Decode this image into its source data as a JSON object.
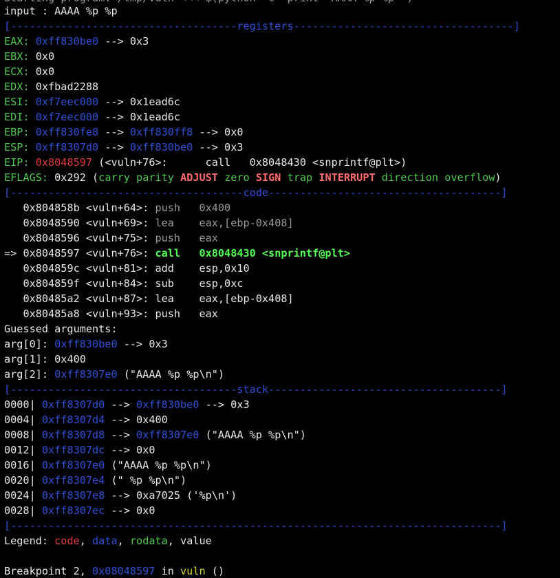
{
  "top_cut": "Starting program: /tmp/vuln <<< $(python -c 'print \"AAAA %p %p\"')",
  "input_line": "input : AAAA %p %p",
  "registers_header": "[------------------------------------registers-----------------------------------]",
  "registers": [
    {
      "name": "EAX:",
      "v1": "0xff830be0",
      "rest": " --> 0x3"
    },
    {
      "name": "EBX:",
      "v1": "",
      "rest": " 0x0"
    },
    {
      "name": "ECX:",
      "v1": "",
      "rest": " 0x0"
    },
    {
      "name": "EDX:",
      "v1": "",
      "rest": " 0xfbad2288"
    },
    {
      "name": "ESI:",
      "v1": "0xf7eec000",
      "rest": " --> 0x1ead6c"
    },
    {
      "name": "EDI:",
      "v1": "0xf7eec000",
      "rest": " --> 0x1ead6c"
    },
    {
      "name": "EBP:",
      "v1": "0xff830fe8",
      "arrow": " --> ",
      "v2": "0xff830ff8",
      "rest": " --> 0x0"
    },
    {
      "name": "ESP:",
      "v1": "0xff8307d0",
      "arrow": " --> ",
      "v2": "0xff830be0",
      "rest": " --> 0x3"
    }
  ],
  "eip": {
    "name": "EIP:",
    "addr": "0x8048597",
    "rest": " (<vuln+76>:      call   0x8048430 <snprintf@plt>)"
  },
  "eflags": {
    "name": "EFLAGS:",
    "value": " 0x292 (",
    "flags": [
      {
        "t": "carry",
        "s": "g"
      },
      {
        "t": "parity",
        "s": "g"
      },
      {
        "t": "ADJUST",
        "s": "r"
      },
      {
        "t": "zero",
        "s": "g"
      },
      {
        "t": "SIGN",
        "s": "r"
      },
      {
        "t": "trap",
        "s": "g"
      },
      {
        "t": "INTERRUPT",
        "s": "r"
      },
      {
        "t": "direction",
        "s": "g"
      },
      {
        "t": "overflow",
        "s": "g"
      }
    ],
    "close": ")"
  },
  "code_header": "[-------------------------------------code-------------------------------------]",
  "code": [
    {
      "prefix": "   ",
      "addr": "0x804858b",
      "sym": " <vuln+64>:",
      "ins": " push   0x400",
      "current": false
    },
    {
      "prefix": "   ",
      "addr": "0x8048590",
      "sym": " <vuln+69>:",
      "ins": " lea    eax,[ebp-0x408]",
      "current": false
    },
    {
      "prefix": "   ",
      "addr": "0x8048596",
      "sym": " <vuln+75>:",
      "ins": " push   eax",
      "current": false
    },
    {
      "prefix": "=> ",
      "addr": "0x8048597",
      "sym": " <vuln+76>:",
      "ins": " call   0x8048430 <snprintf@plt>",
      "current": true
    },
    {
      "prefix": "   ",
      "addr": "0x804859c",
      "sym": " <vuln+81>:",
      "ins": " add    esp,0x10",
      "current": false
    },
    {
      "prefix": "   ",
      "addr": "0x804859f",
      "sym": " <vuln+84>:",
      "ins": " sub    esp,0xc",
      "current": false
    },
    {
      "prefix": "   ",
      "addr": "0x80485a2",
      "sym": " <vuln+87>:",
      "ins": " lea    eax,[ebp-0x408]",
      "current": false
    },
    {
      "prefix": "   ",
      "addr": "0x80485a8",
      "sym": " <vuln+93>:",
      "ins": " push   eax",
      "current": false
    }
  ],
  "guessed_title": "Guessed arguments:",
  "args": [
    {
      "name": "arg[0]:",
      "v1": "0xff830be0",
      "rest": " --> 0x3"
    },
    {
      "name": "arg[1]:",
      "v1": "",
      "rest": " 0x400"
    },
    {
      "name": "arg[2]:",
      "v1": "0xff8307e0",
      "rest": " (\"AAAA %p %p\\n\")"
    }
  ],
  "stack_header": "[------------------------------------stack-------------------------------------]",
  "stack": [
    {
      "off": "0000|",
      "addr": "0xff8307d0",
      "arrow": " --> ",
      "v2": "0xff830be0",
      "rest": " --> 0x3"
    },
    {
      "off": "0004|",
      "addr": "0xff8307d4",
      "arrow": "",
      "v2": "",
      "rest": " --> 0x400"
    },
    {
      "off": "0008|",
      "addr": "0xff8307d8",
      "arrow": " --> ",
      "v2": "0xff8307e0",
      "rest": " (\"AAAA %p %p\\n\")"
    },
    {
      "off": "0012|",
      "addr": "0xff8307dc",
      "arrow": "",
      "v2": "",
      "rest": " --> 0x0"
    },
    {
      "off": "0016|",
      "addr": "0xff8307e0",
      "arrow": "",
      "v2": "",
      "rest": " (\"AAAA %p %p\\n\")"
    },
    {
      "off": "0020|",
      "addr": "0xff8307e4",
      "arrow": "",
      "v2": "",
      "rest": " (\" %p %p\\n\")"
    },
    {
      "off": "0024|",
      "addr": "0xff8307e8",
      "arrow": "",
      "v2": "",
      "rest": " --> 0xa7025 ('%p\\n')"
    },
    {
      "off": "0028|",
      "addr": "0xff8307ec",
      "arrow": "",
      "v2": "",
      "rest": " --> 0x0"
    }
  ],
  "end_header": "[------------------------------------------------------------------------------]",
  "legend": {
    "label": "Legend: ",
    "code": "code",
    "sep1": ", ",
    "data": "data",
    "sep2": ", ",
    "rodata": "rodata",
    "sep3": ", ",
    "value": "value"
  },
  "breakpoint": {
    "pre": "Breakpoint 2, ",
    "addr": "0x08048597",
    "mid": " in ",
    "func": "vuln",
    "post": " ()"
  }
}
